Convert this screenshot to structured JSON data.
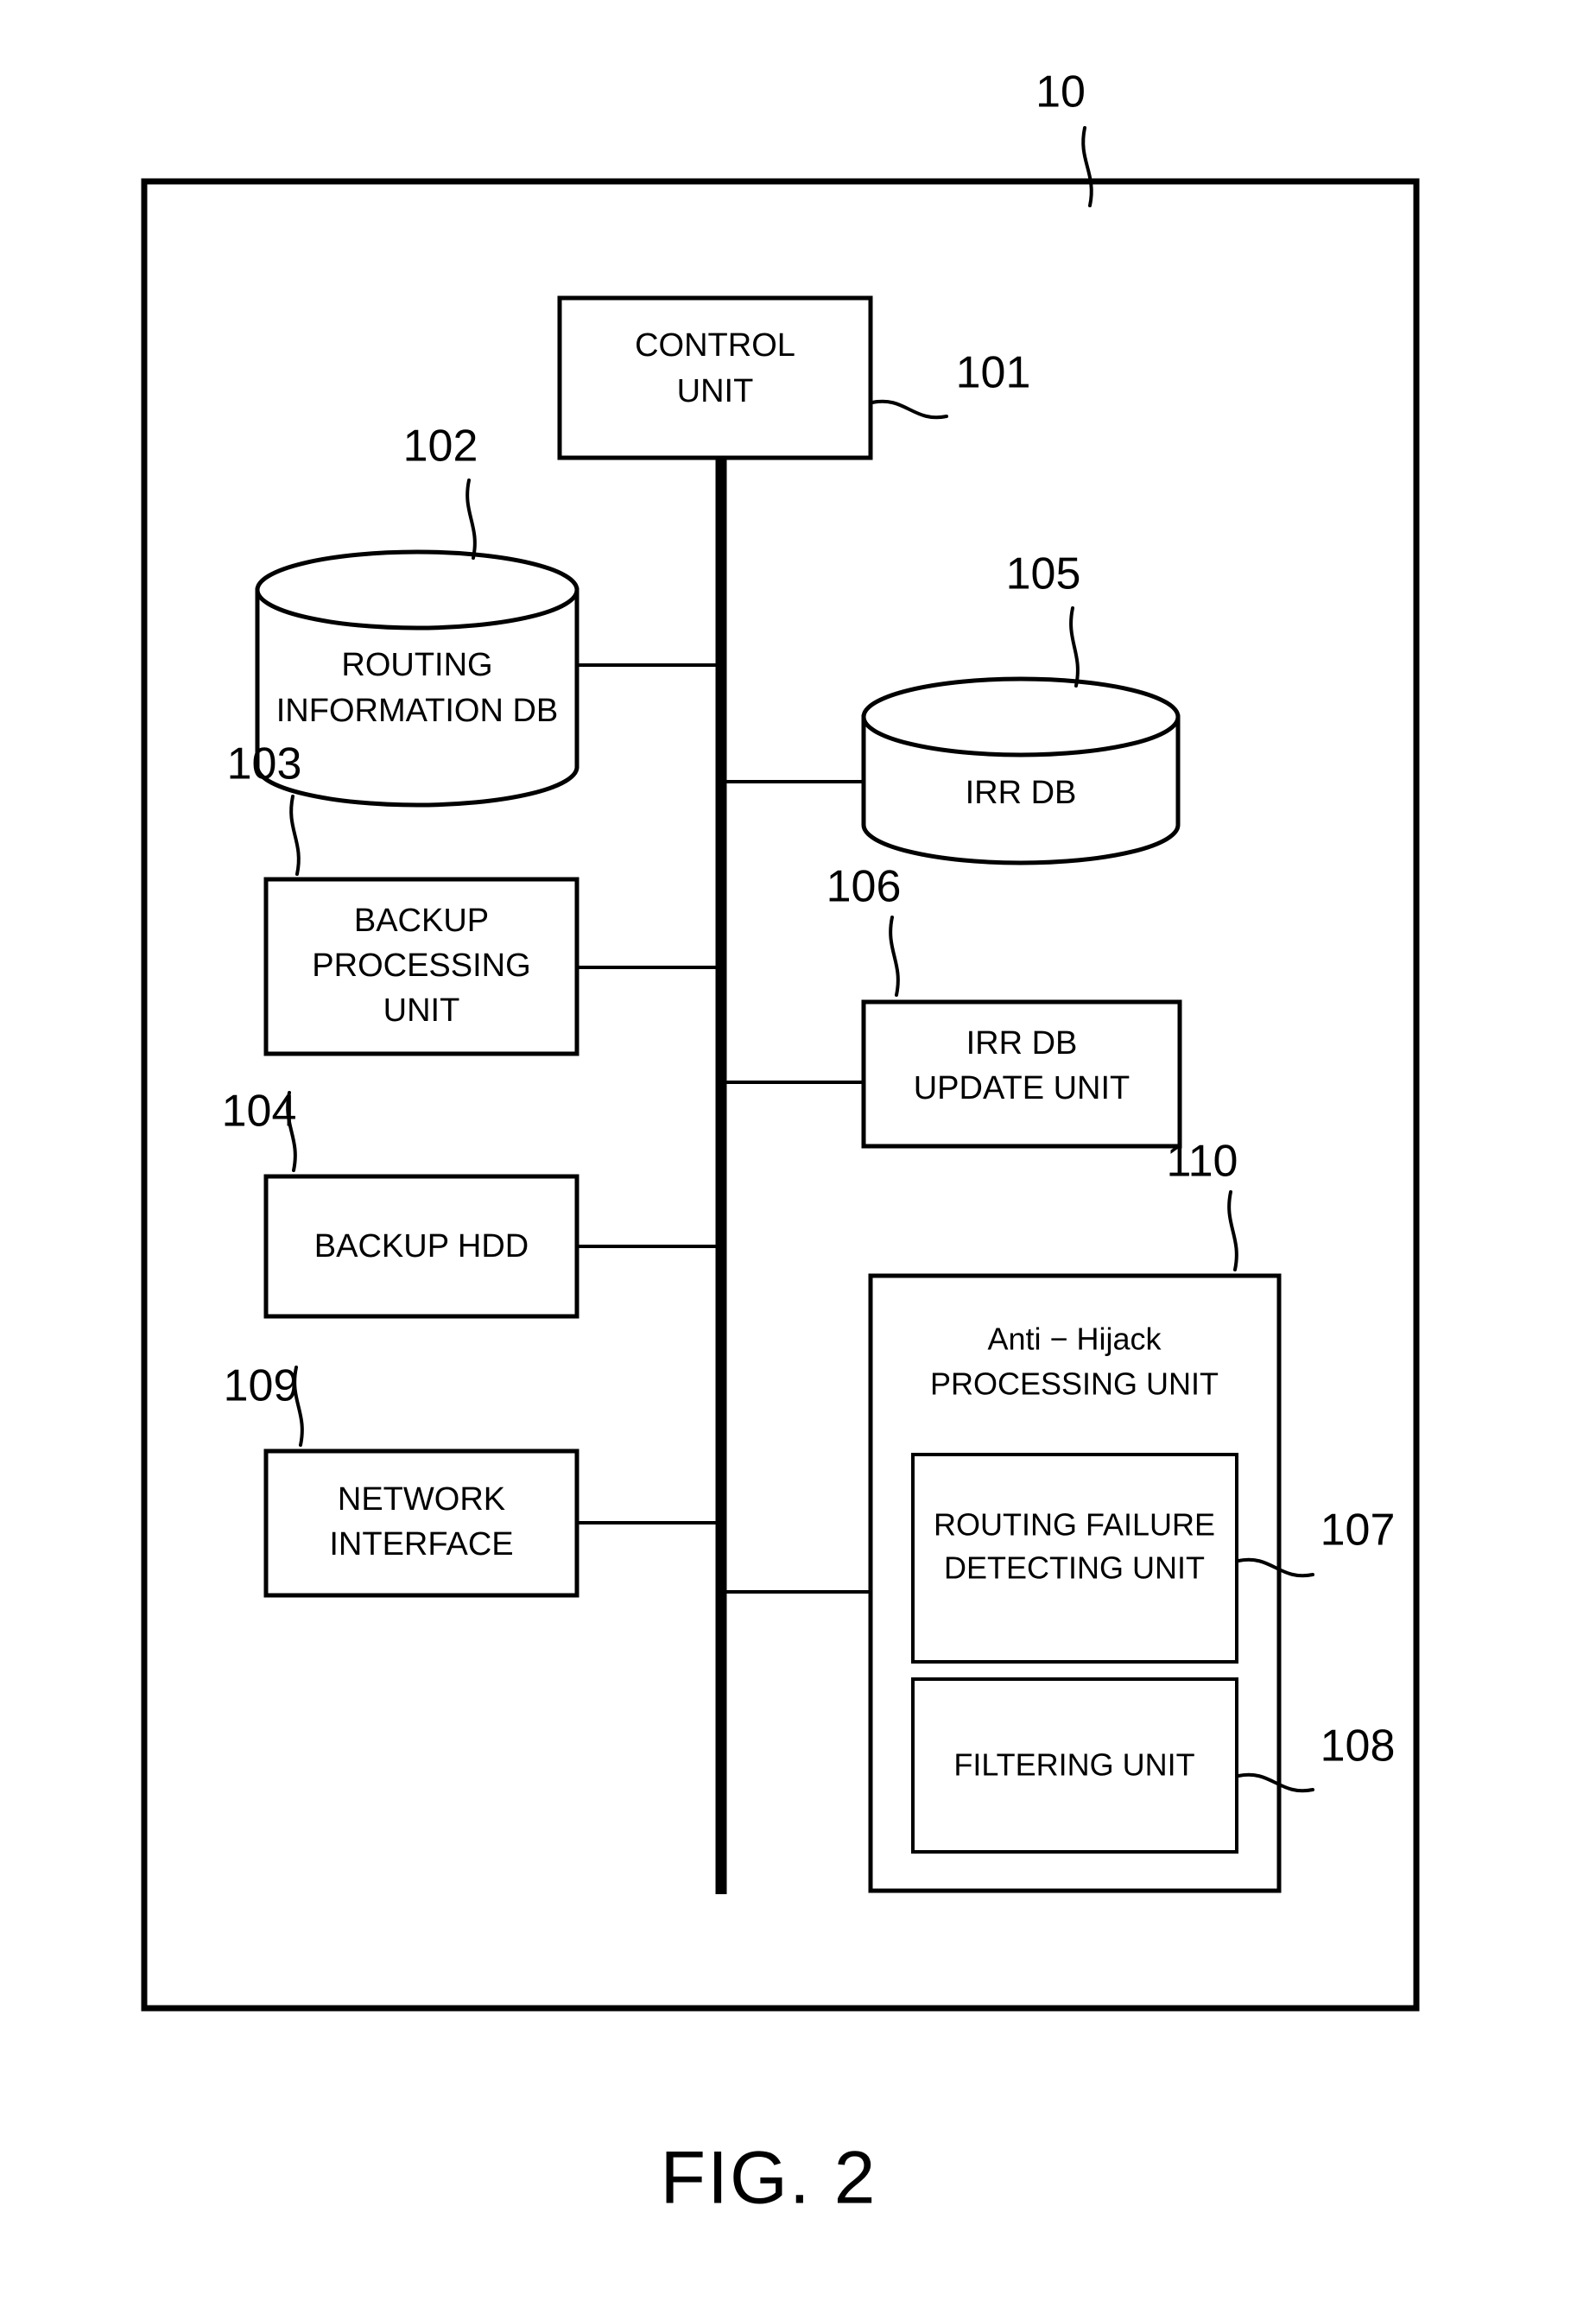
{
  "figure": {
    "caption": "FIG. 2",
    "system_ref": "10"
  },
  "blocks": [
    {
      "id": "control-unit",
      "shape": "rect",
      "ref": "101",
      "lines": [
        "CONTROL",
        "UNIT"
      ]
    },
    {
      "id": "routing-information-db",
      "shape": "cylinder",
      "ref": "102",
      "lines": [
        "ROUTING",
        "INFORMATION DB"
      ]
    },
    {
      "id": "backup-processing-unit",
      "shape": "rect",
      "ref": "103",
      "lines": [
        "BACKUP",
        "PROCESSING",
        "UNIT"
      ]
    },
    {
      "id": "backup-hdd",
      "shape": "rect",
      "ref": "104",
      "lines": [
        "BACKUP HDD"
      ]
    },
    {
      "id": "irr-db",
      "shape": "cylinder",
      "ref": "105",
      "lines": [
        "IRR DB"
      ]
    },
    {
      "id": "irr-db-update-unit",
      "shape": "rect",
      "ref": "106",
      "lines": [
        "IRR DB",
        "UPDATE UNIT"
      ]
    },
    {
      "id": "routing-failure-detecting-unit",
      "shape": "rect",
      "ref": "107",
      "lines": [
        "ROUTING FAILURE",
        "DETECTING UNIT"
      ]
    },
    {
      "id": "filtering-unit",
      "shape": "rect",
      "ref": "108",
      "lines": [
        "FILTERING UNIT"
      ]
    },
    {
      "id": "network-interface",
      "shape": "rect",
      "ref": "109",
      "lines": [
        "NETWORK",
        "INTERFACE"
      ]
    },
    {
      "id": "anti-hijack-processing-unit",
      "shape": "rect",
      "ref": "110",
      "lines": [
        "Anti − Hijack",
        "PROCESSING UNIT"
      ]
    }
  ],
  "text": {
    "control_unit_l1": "CONTROL",
    "control_unit_l2": "UNIT",
    "routing_info_db_l1": "ROUTING",
    "routing_info_db_l2": "INFORMATION DB",
    "backup_processing_l1": "BACKUP",
    "backup_processing_l2": "PROCESSING",
    "backup_processing_l3": "UNIT",
    "backup_hdd": "BACKUP HDD",
    "network_interface_l1": "NETWORK",
    "network_interface_l2": "INTERFACE",
    "irr_db": "IRR DB",
    "irr_db_update_l1": "IRR DB",
    "irr_db_update_l2": "UPDATE UNIT",
    "anti_hijack_l1": "Anti − Hijack",
    "anti_hijack_l2": "PROCESSING UNIT",
    "routing_failure_l1": "ROUTING FAILURE",
    "routing_failure_l2": "DETECTING UNIT",
    "filtering_unit": "FILTERING UNIT"
  },
  "refs": {
    "system": "10",
    "control_unit": "101",
    "routing_info_db": "102",
    "backup_processing_unit": "103",
    "backup_hdd": "104",
    "irr_db": "105",
    "irr_db_update_unit": "106",
    "routing_failure_detecting_unit": "107",
    "filtering_unit": "108",
    "network_interface": "109",
    "anti_hijack_processing_unit": "110"
  },
  "colors": {
    "ink": "#000000",
    "paper": "#ffffff"
  }
}
